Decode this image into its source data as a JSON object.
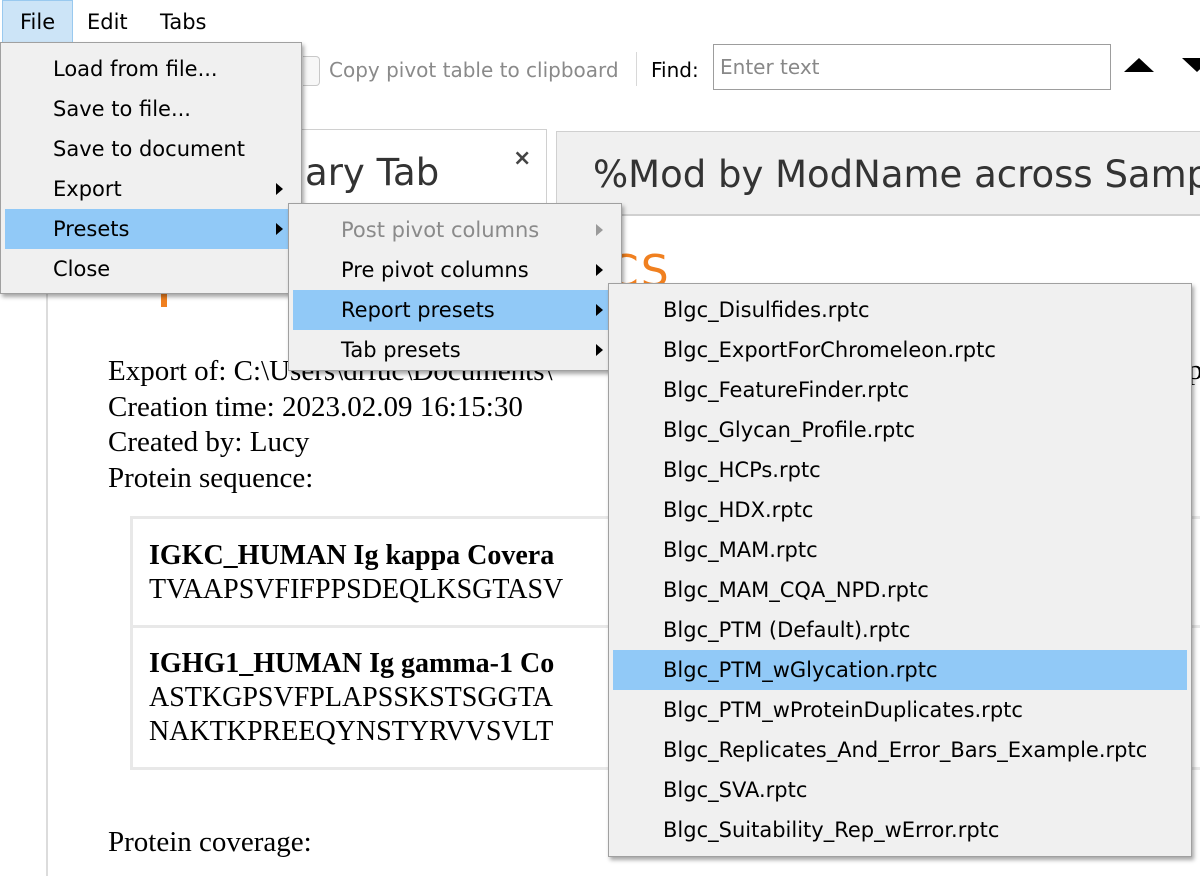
{
  "menubar": {
    "items": [
      "File",
      "Edit",
      "Tabs"
    ]
  },
  "toolbar": {
    "copy_label": "Copy pivot table to clipboard",
    "find_label": "Find:",
    "find_placeholder": "Enter text"
  },
  "tabs": [
    {
      "label": "mary Tab",
      "close": "×"
    },
    {
      "label": "%Mod by ModName across Samp"
    }
  ],
  "content": {
    "logo_fragment": "CS",
    "info_lines": [
      "Export of: C:\\Users\\drfuc\\Documents\\",
      "Creation time: 2023.02.09 16:15:30",
      "Created by: Lucy",
      "Protein sequence:"
    ],
    "info_right_fragment": "p",
    "proteins": [
      {
        "title": "IGKC_HUMAN Ig kappa Covera",
        "seq_lines": [
          "TVAAPSVFIFPPSDEQLKSGTASV"
        ]
      },
      {
        "title": "IGHG1_HUMAN Ig gamma-1 Co",
        "seq_lines": [
          "ASTKGPSVFPLAPSSKSTSGGTA",
          "NAKTKPREEQYNSTYRVVSVLT"
        ]
      }
    ],
    "coverage_label": "Protein coverage:"
  },
  "file_menu": {
    "items": [
      {
        "label": "Load from file...",
        "submenu": false
      },
      {
        "label": "Save to file...",
        "submenu": false
      },
      {
        "label": "Save to document",
        "submenu": false
      },
      {
        "label": "Export",
        "submenu": true
      },
      {
        "label": "Presets",
        "submenu": true,
        "highlighted": true
      },
      {
        "label": "Close",
        "submenu": false
      }
    ]
  },
  "presets_menu": {
    "items": [
      {
        "label": "Post pivot columns",
        "submenu": true,
        "disabled": true
      },
      {
        "label": "Pre pivot columns",
        "submenu": true
      },
      {
        "label": "Report presets",
        "submenu": true,
        "highlighted": true
      },
      {
        "label": "Tab presets",
        "submenu": true
      }
    ]
  },
  "report_presets_menu": {
    "items": [
      "Blgc_Disulfides.rptc",
      "Blgc_ExportForChromeleon.rptc",
      "Blgc_FeatureFinder.rptc",
      "Blgc_Glycan_Profile.rptc",
      "Blgc_HCPs.rptc",
      "Blgc_HDX.rptc",
      "Blgc_MAM.rptc",
      "Blgc_MAM_CQA_NPD.rptc",
      "Blgc_PTM (Default).rptc",
      "Blgc_PTM_wGlycation.rptc",
      "Blgc_PTM_wProteinDuplicates.rptc",
      "Blgc_Replicates_And_Error_Bars_Example.rptc",
      "Blgc_SVA.rptc",
      "Blgc_Suitability_Rep_wError.rptc"
    ],
    "highlighted_index": 9
  },
  "colors": {
    "menu_highlight": "#91c9f7",
    "menu_bg": "#f0f0f0",
    "logo_orange": "#f08020"
  }
}
